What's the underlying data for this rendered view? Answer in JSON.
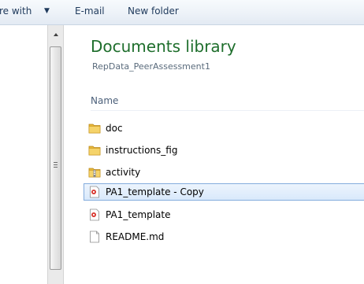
{
  "toolbar": {
    "share_label": "re with",
    "email_label": "E-mail",
    "new_folder_label": "New folder"
  },
  "library": {
    "title": "Documents library",
    "subtitle": "RepData_PeerAssessment1"
  },
  "columns": {
    "name_header": "Name"
  },
  "files": [
    {
      "name": "doc",
      "icon": "folder-icon"
    },
    {
      "name": "instructions_fig",
      "icon": "folder-icon"
    },
    {
      "name": "activity",
      "icon": "zip-folder-icon"
    },
    {
      "name": "PA1_template - Copy",
      "icon": "rmd-file-icon"
    },
    {
      "name": "PA1_template",
      "icon": "rmd-file-icon"
    },
    {
      "name": "README.md",
      "icon": "blank-file-icon"
    }
  ],
  "selected_file": "PA1_template - Copy",
  "colors": {
    "title_green": "#1e6e2c",
    "selection_border": "#84acdd",
    "folder_yellow": "#e8b838"
  }
}
